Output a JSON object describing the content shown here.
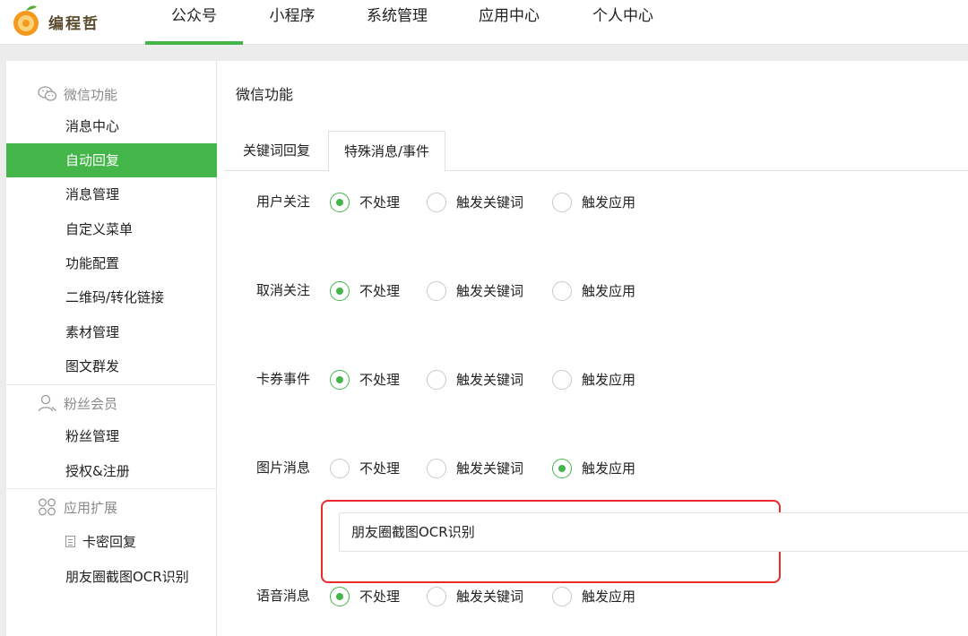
{
  "brand": {
    "name": "编程哲",
    "logo_icon": "orange-logo-icon",
    "accent": "#44b549",
    "highlight": "#e82a2a"
  },
  "topnav": {
    "items": [
      {
        "label": "公众号",
        "active": true
      },
      {
        "label": "小程序",
        "active": false
      },
      {
        "label": "系统管理",
        "active": false
      },
      {
        "label": "应用中心",
        "active": false
      },
      {
        "label": "个人中心",
        "active": false
      }
    ]
  },
  "sidebar": {
    "sections": [
      {
        "title": "微信功能",
        "icon": "wechat-icon",
        "items": [
          "消息中心",
          "自动回复",
          "消息管理",
          "自定义菜单",
          "功能配置",
          "二维码/转化链接",
          "素材管理",
          "图文群发"
        ],
        "active_item": "自动回复"
      },
      {
        "title": "粉丝会员",
        "icon": "user-icon",
        "items": [
          "粉丝管理",
          "授权&注册"
        ]
      },
      {
        "title": "应用扩展",
        "icon": "apps-icon",
        "items": [
          "卡密回复",
          "朋友圈截图OCR识别"
        ]
      }
    ]
  },
  "main": {
    "title": "微信功能",
    "tabs": [
      {
        "label": "关键词回复",
        "active": false
      },
      {
        "label": "特殊消息/事件",
        "active": true
      }
    ],
    "option_labels": [
      "不处理",
      "触发关键词",
      "触发应用"
    ],
    "rows": [
      {
        "label": "用户关注",
        "selected": "不处理"
      },
      {
        "label": "取消关注",
        "selected": "不处理"
      },
      {
        "label": "卡券事件",
        "selected": "不处理"
      },
      {
        "label": "图片消息",
        "selected": "触发应用"
      },
      {
        "label": "语音消息",
        "selected": "不处理"
      }
    ],
    "image_app_field": {
      "value": "朋友圈截图OCR识别"
    }
  }
}
